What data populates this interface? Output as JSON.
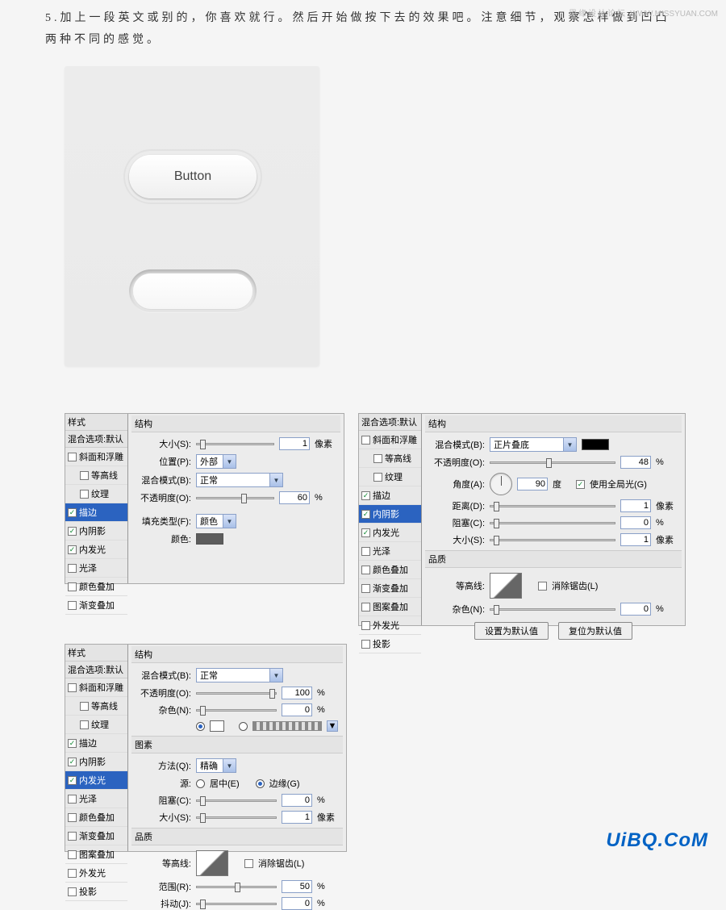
{
  "instruction": "5.加上一段英文或别的，你喜欢就行。然后开始做按下去的效果吧。注意细节，观察怎样做到凹凸两种不同的感觉。",
  "watermark_top": {
    "label": "思缘设计论坛",
    "url": "WWW.MISSYUAN.COM"
  },
  "watermark_bottom": "UiBQ.CoM",
  "preview": {
    "button_label": "Button"
  },
  "sidebar": {
    "hdr1": "样式",
    "hdr2": "混合选项:默认",
    "bevel": "斜面和浮雕",
    "contour": "等高线",
    "texture": "纹理",
    "stroke": "描边",
    "inner_shadow": "内阴影",
    "inner_glow": "内发光",
    "satin": "光泽",
    "color_overlay": "颜色叠加",
    "grad_overlay": "渐变叠加",
    "pattern_overlay": "图案叠加",
    "outer_glow": "外发光",
    "drop_shadow": "投影"
  },
  "labels": {
    "structure": "结构",
    "elements": "图素",
    "quality": "品质",
    "size": "大小(S):",
    "position": "位置(P):",
    "blend_mode": "混合模式(B):",
    "opacity": "不透明度(O):",
    "fill_type": "填充类型(F):",
    "color_lbl": "颜色:",
    "noise": "杂色(N):",
    "method": "方法(Q):",
    "source": "源:",
    "choke": "阻塞(C):",
    "contour": "等高线:",
    "range": "范围(R):",
    "jitter": "抖动(J):",
    "angle": "角度(A):",
    "distance": "距离(D):",
    "use_global": "使用全局光(G)",
    "antialias": "消除锯齿(L)",
    "set_default": "设置为默认值",
    "reset_default": "复位为默认值",
    "center": "居中(E)",
    "edge": "边缘(G)",
    "px": "像素",
    "pct": "%",
    "deg": "度"
  },
  "values": {
    "pos_out": "外部",
    "mode_normal": "正常",
    "mode_multiply": "正片叠底",
    "fill_color": "颜色",
    "method_precise": "精确"
  },
  "p1": {
    "size": "1",
    "opacity": "60"
  },
  "p2": {
    "opacity": "48",
    "angle": "90",
    "distance": "1",
    "choke": "0",
    "size": "1",
    "noise": "0"
  },
  "p3": {
    "opacity": "100",
    "noise": "0",
    "choke": "0",
    "size": "1",
    "range": "50",
    "jitter": "0"
  }
}
